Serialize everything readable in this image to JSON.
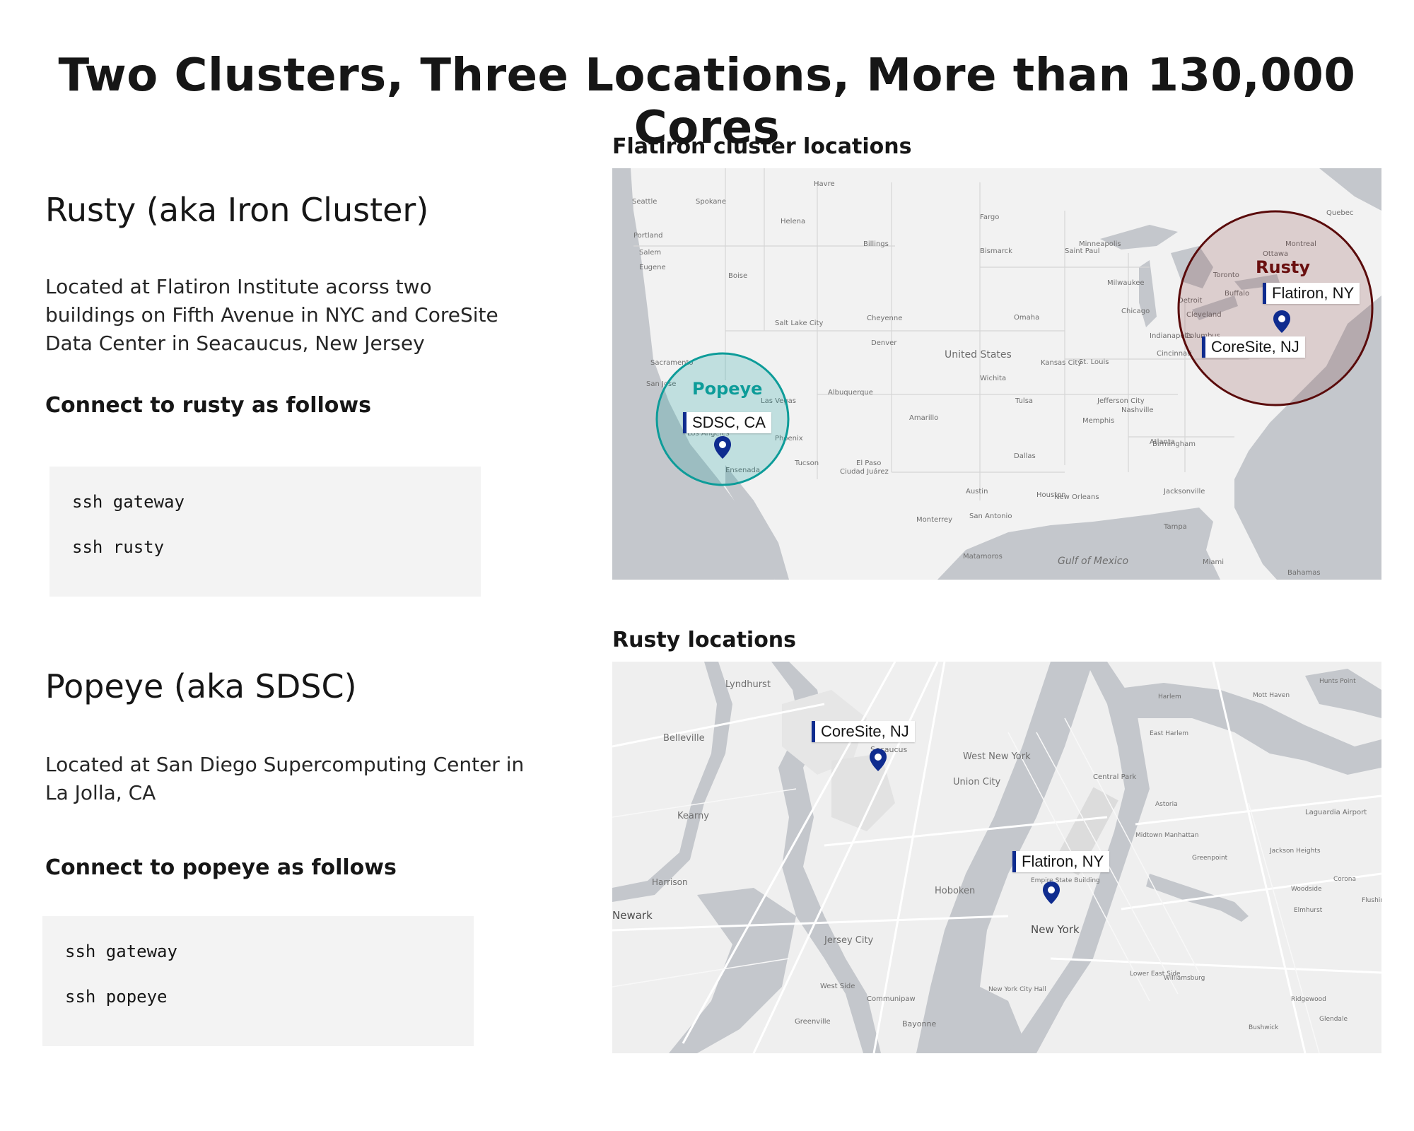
{
  "page": {
    "title": "Two Clusters, Three Locations, More than 130,000 Cores"
  },
  "rusty": {
    "title": "Rusty (aka Iron Cluster)",
    "description": "Located at Flatiron Institute acorss two buildings on Fifth Avenue in NYC and CoreSite Data Center in Seacaucus, New Jersey",
    "connect_title": "Connect to rusty as follows",
    "commands": [
      "ssh gateway",
      "ssh rusty"
    ]
  },
  "popeye": {
    "title": "Popeye (aka SDSC)",
    "description": "Located at San Diego Supercomputing Center in La Jolla, CA",
    "connect_title": "Connect to popeye as follows",
    "commands": [
      "ssh gateway",
      "ssh popeye"
    ]
  },
  "map_us": {
    "title": "Flatiron cluster locations",
    "clusters": [
      {
        "name": "Popeye",
        "color": "#0d9c99"
      },
      {
        "name": "Rusty",
        "color": "#6a1010"
      }
    ],
    "markers": [
      "SDSC, CA",
      "Flatiron, NY",
      "CoreSite, NJ"
    ],
    "labels": {
      "country": "United States",
      "gulf": "Gulf of Mexico",
      "cities": [
        "Seattle",
        "Spokane",
        "Portland",
        "Salem",
        "Eugene",
        "Boise",
        "Helena",
        "Havre",
        "Billings",
        "Fargo",
        "Bismarck",
        "Saint Paul",
        "Minneapolis",
        "Milwaukee",
        "Detroit",
        "Toronto",
        "Montreal",
        "Ottawa",
        "Quebec",
        "Cleveland",
        "Buffalo",
        "Sacramento",
        "San Jose",
        "Los Angeles",
        "Ensenada",
        "Las Vegas",
        "Salt Lake City",
        "Denver",
        "Cheyenne",
        "Omaha",
        "Kansas City",
        "St. Louis",
        "Chicago",
        "Indianapolis",
        "Cincinnati",
        "Columbus",
        "Nashville",
        "Memphis",
        "Dallas",
        "Austin",
        "San Antonio",
        "Houston",
        "New Orleans",
        "Atlanta",
        "Jacksonville",
        "Tampa",
        "Miami",
        "Tucson",
        "Phoenix",
        "Albuquerque",
        "El Paso",
        "Ciudad Juárez",
        "Monterrey",
        "Matamoros",
        "Tulsa",
        "Amarillo",
        "Birmingham",
        "Jefferson City",
        "Wichita",
        "Bahamas"
      ]
    }
  },
  "map_nyc": {
    "title": "Rusty locations",
    "markers": [
      "CoreSite, NJ",
      "Flatiron, NY"
    ],
    "labels": [
      "Lyndhurst",
      "Belleville",
      "Kearny",
      "Harrison",
      "Newark",
      "Jersey City",
      "Hoboken",
      "Union City",
      "West New York",
      "Secaucus",
      "New York",
      "Empire State Building",
      "Central Park",
      "Laguardia Airport",
      "Woodside",
      "Elmhurst",
      "Jackson Heights",
      "Corona",
      "Williamsburg",
      "Greenpoint",
      "Bushwick",
      "Ridgewood",
      "Glendale",
      "Harlem",
      "East Harlem",
      "Mott Haven",
      "Hunts Point",
      "Astoria",
      "Midtown Manhattan",
      "Lower East Side",
      "Bayonne",
      "Greenville",
      "West Side",
      "Communipaw",
      "New York City Hall",
      "Flushing"
    ]
  }
}
